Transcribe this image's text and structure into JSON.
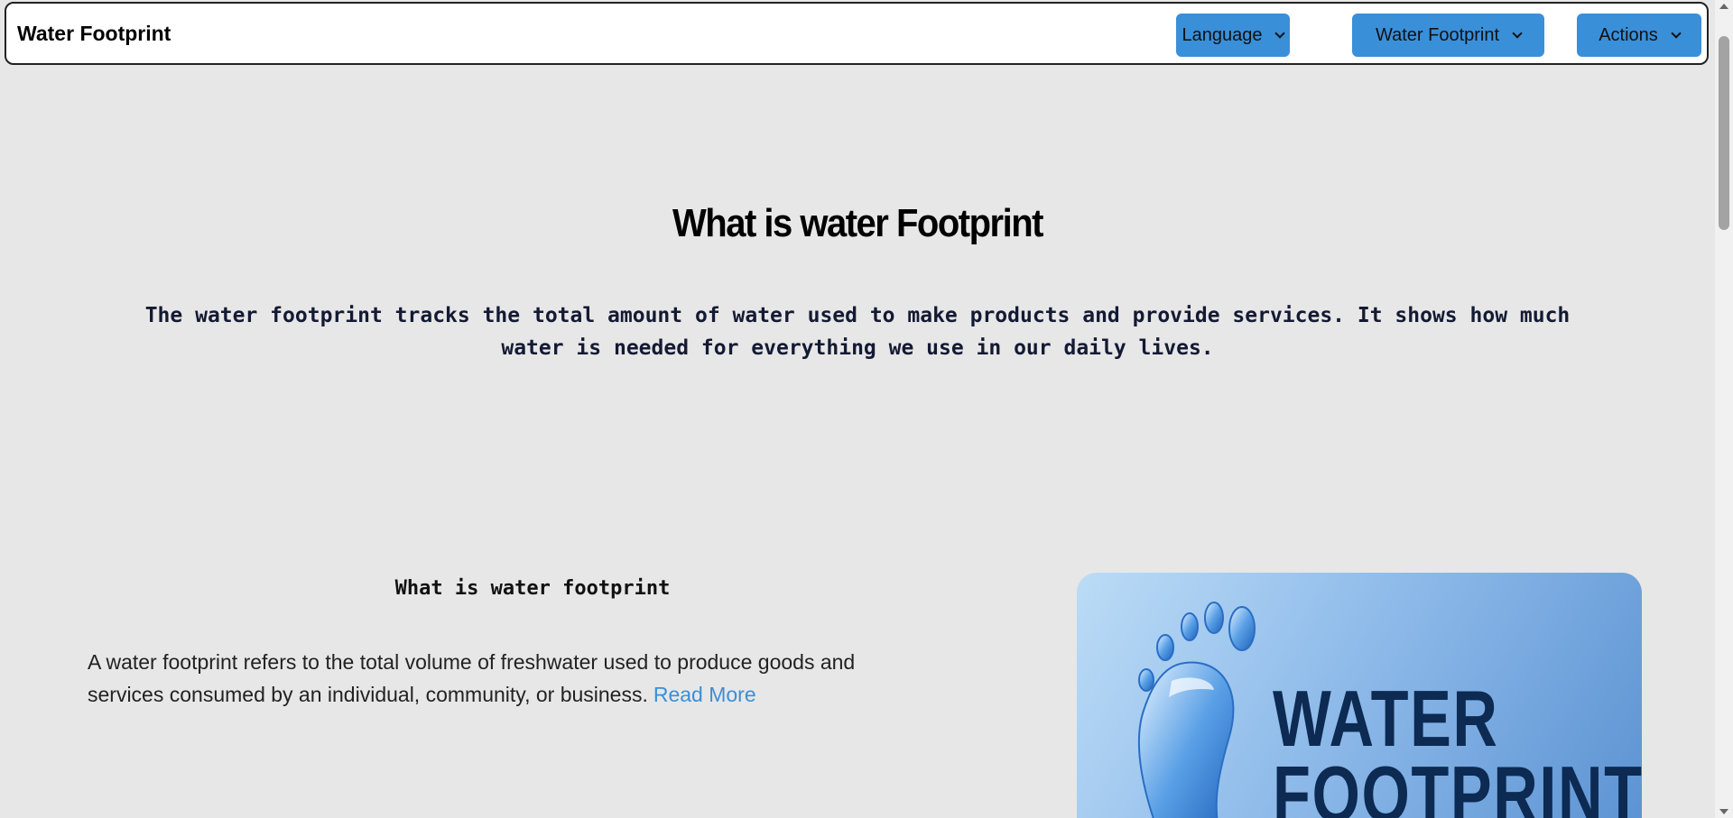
{
  "navbar": {
    "brand": "Water Footprint",
    "buttons": [
      {
        "label": "Language"
      },
      {
        "label": "Water Footprint"
      },
      {
        "label": "Actions"
      }
    ]
  },
  "hero": {
    "title": "What is water Footprint",
    "text": "The water footprint tracks the total amount of water used to make products and provide services. It shows how much water is needed for everything we use in our daily lives."
  },
  "section": {
    "title": "What is water footprint",
    "text": "A water footprint refers to the total volume of freshwater used to produce goods and services consumed by an individual, community, or business.",
    "link": "Read More"
  },
  "image": {
    "caption_line1": "WATER",
    "caption_line2": "FOOTPRINT:"
  },
  "colors": {
    "accent": "#3a8fd9",
    "background": "#e7e7e7",
    "image_text": "#0c2a52"
  },
  "icons": {
    "dropdown": "chevron-down-icon"
  }
}
